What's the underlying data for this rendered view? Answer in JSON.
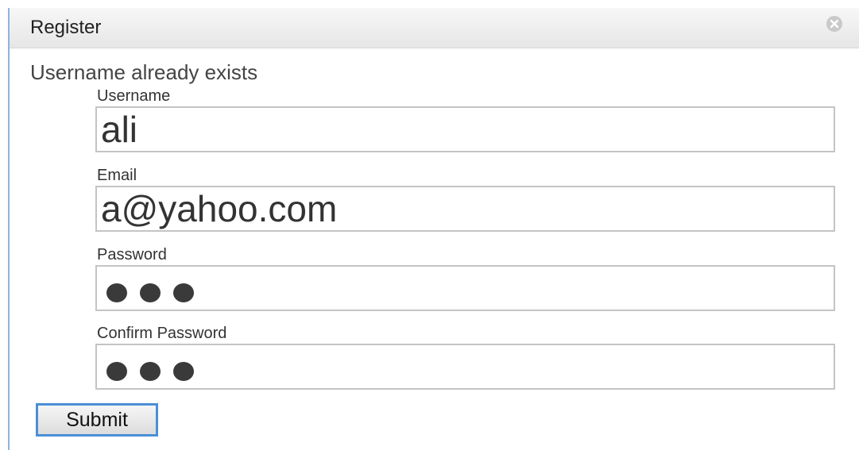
{
  "dialog": {
    "title": "Register",
    "close_icon": "close-circle-icon"
  },
  "error_message": "Username already exists",
  "form": {
    "username": {
      "label": "Username",
      "value": "ali"
    },
    "email": {
      "label": "Email",
      "value": "a@yahoo.com"
    },
    "password": {
      "label": "Password",
      "masked_length": 3
    },
    "confirm_password": {
      "label": "Confirm Password",
      "masked_length": 3
    }
  },
  "submit_label": "Submit",
  "colors": {
    "accent_border": "#4a8fd6",
    "input_border": "#c4c4c4",
    "titlebar_bg": "#e6e6e6"
  }
}
